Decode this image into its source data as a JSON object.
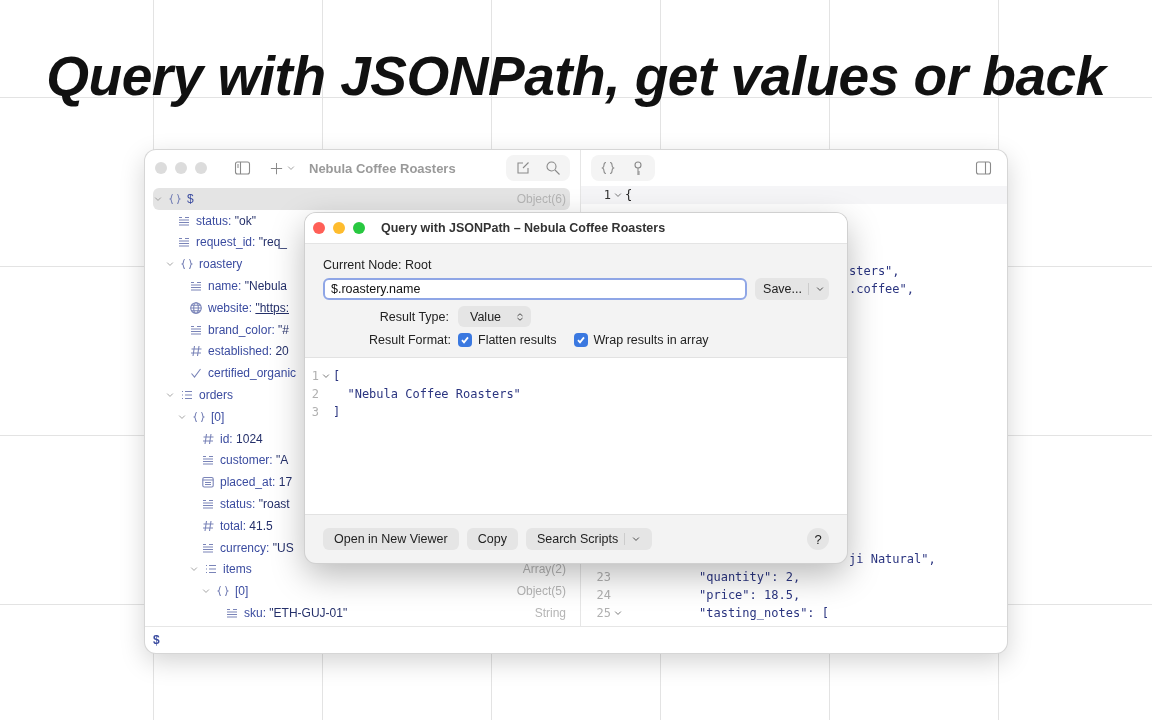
{
  "headline": "Query with JSONPath, get values or back",
  "window": {
    "title": "Nebula Coffee Roasters",
    "active": false
  },
  "tree": [
    {
      "kind": "object",
      "key": "$",
      "expanded": true,
      "selected": true,
      "type": "Object(6)",
      "children": [
        {
          "kind": "string",
          "key": "status:",
          "value": "\"ok\"",
          "selected": false
        },
        {
          "kind": "string",
          "key": "request_id:",
          "value": "\"req_",
          "selected": false
        },
        {
          "kind": "object",
          "key": "roastery",
          "expanded": true,
          "selected": false,
          "children": [
            {
              "kind": "string",
              "key": "name:",
              "value": "\"Nebula",
              "selected": false
            },
            {
              "kind": "link",
              "key": "website:",
              "value": "\"https:",
              "selected": false
            },
            {
              "kind": "string",
              "key": "brand_color:",
              "value": "\"#",
              "selected": false
            },
            {
              "kind": "number",
              "key": "established:",
              "value": "20",
              "selected": false
            },
            {
              "kind": "boolean",
              "key": "certified_organic",
              "selected": false
            }
          ]
        },
        {
          "kind": "array",
          "key": "orders",
          "expanded": true,
          "selected": false,
          "children": [
            {
              "kind": "object",
              "key": "[0]",
              "expanded": true,
              "selected": false,
              "children": [
                {
                  "kind": "number",
                  "key": "id:",
                  "value": "1024",
                  "selected": false
                },
                {
                  "kind": "string",
                  "key": "customer:",
                  "value": "\"A",
                  "selected": false
                },
                {
                  "kind": "date",
                  "key": "placed_at:",
                  "value": "17",
                  "selected": false
                },
                {
                  "kind": "string",
                  "key": "status:",
                  "value": "\"roast",
                  "selected": false
                },
                {
                  "kind": "number",
                  "key": "total:",
                  "value": "41.5",
                  "selected": false
                },
                {
                  "kind": "string",
                  "key": "currency:",
                  "value": "\"US",
                  "selected": false
                },
                {
                  "kind": "array",
                  "key": "items",
                  "expanded": true,
                  "selected": false,
                  "type": "Array(2)",
                  "children": [
                    {
                      "kind": "object",
                      "key": "[0]",
                      "expanded": true,
                      "selected": false,
                      "type": "Object(5)",
                      "children": [
                        {
                          "kind": "string",
                          "key": "sku:",
                          "value": "\"ETH-GUJ-01\"",
                          "selected": false,
                          "type": "String"
                        }
                      ]
                    }
                  ]
                }
              ]
            }
          ]
        }
      ]
    }
  ],
  "status_bar": {
    "path": "$"
  },
  "code": {
    "top": [
      {
        "kind": "line",
        "number": "1",
        "foldable": true,
        "text": "{",
        "current": true
      }
    ],
    "upper_cut": [
      {
        "kind": "cut",
        "text": "sters\","
      },
      {
        "kind": "cut",
        "text": ".coffee\","
      }
    ],
    "bottom": [
      {
        "kind": "cut",
        "text": "ji Natural\","
      },
      {
        "kind": "line",
        "number": "23",
        "foldable": false,
        "text": "\"quantity\": 2,",
        "current": false
      },
      {
        "kind": "line",
        "number": "24",
        "foldable": false,
        "text": "\"price\": 18.5,",
        "current": false
      },
      {
        "kind": "line",
        "number": "25",
        "foldable": true,
        "text": "\"tasting_notes\": [",
        "current": false
      }
    ]
  },
  "dialog": {
    "title": "Query with JSONPath – Nebula Coffee Roasters",
    "current_node": "Current Node: Root",
    "query": "$.roastery.name",
    "save_button": "Save...",
    "result_type_label": "Result Type:",
    "result_type": "Value",
    "result_format_label": "Result Format:",
    "options": [
      {
        "label": "Flatten results",
        "checked": true
      },
      {
        "label": "Wrap results in array",
        "checked": true
      }
    ],
    "result_lines": [
      {
        "number": "1",
        "foldable": true,
        "text": "["
      },
      {
        "number": "2",
        "foldable": false,
        "text": "  \"Nebula Coffee Roasters\""
      },
      {
        "number": "3",
        "foldable": false,
        "text": "]"
      }
    ],
    "buttons": [
      "Open in New Viewer",
      "Copy"
    ],
    "scripts_button": "Search Scripts",
    "help": "?"
  }
}
